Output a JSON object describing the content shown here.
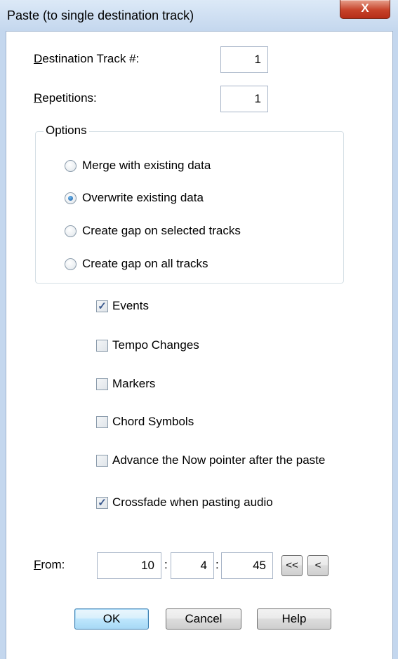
{
  "window": {
    "title": "Paste (to single destination track)",
    "close_label": "X"
  },
  "fields": {
    "destination_track": {
      "label_key": "D",
      "label_rest": "estination Track #:",
      "value": "1"
    },
    "repetitions": {
      "label_key": "R",
      "label_rest": "epetitions:",
      "value": "1"
    }
  },
  "options": {
    "group_label": "Options",
    "radios": [
      {
        "label": "Merge with existing data",
        "checked": false
      },
      {
        "label": "Overwrite existing data",
        "checked": true
      },
      {
        "label": "Create gap on selected tracks",
        "checked": false
      },
      {
        "label": "Create gap on all tracks",
        "checked": false
      }
    ]
  },
  "checkboxes": [
    {
      "label": "Events",
      "checked": true
    },
    {
      "label": "Tempo Changes",
      "checked": false
    },
    {
      "label": "Markers",
      "checked": false
    },
    {
      "label": "Chord Symbols",
      "checked": false
    },
    {
      "label": "Advance the Now pointer after the paste",
      "checked": false
    },
    {
      "label": "Crossfade when pasting audio",
      "checked": true
    }
  ],
  "from": {
    "label_key": "F",
    "label_rest": "rom:",
    "bar": "10",
    "beat": "4",
    "tick": "45",
    "separator": ":",
    "rewind_label": "<<",
    "back_label": "<"
  },
  "buttons": {
    "ok": "OK",
    "cancel": "Cancel",
    "help": "Help"
  },
  "icons": {
    "check": "check-mark-icon"
  }
}
